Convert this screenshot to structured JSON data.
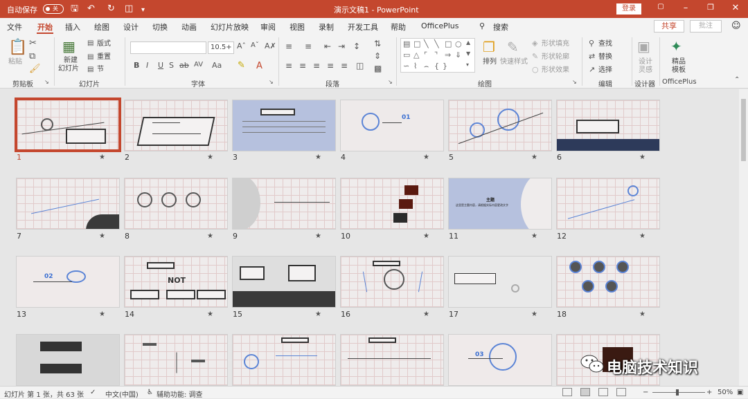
{
  "titlebar": {
    "autosave_label": "自动保存",
    "autosave_state": "关",
    "doc_title": "演示文稿1 - PowerPoint",
    "login": "登录",
    "qa_icons": [
      "save-icon",
      "undo-icon",
      "redo-icon",
      "start-slideshow-icon",
      "customize-icon"
    ]
  },
  "menu": {
    "tabs": [
      "文件",
      "开始",
      "插入",
      "绘图",
      "设计",
      "切换",
      "动画",
      "幻灯片放映",
      "审阅",
      "视图",
      "录制",
      "开发工具",
      "帮助",
      "OfficePlus",
      "搜索"
    ],
    "active": "开始",
    "share": "共享",
    "comment": "批注"
  },
  "ribbon": {
    "groups": [
      "剪贴板",
      "幻灯片",
      "字体",
      "段落",
      "绘图",
      "编辑",
      "设计器",
      "OfficePlus"
    ],
    "paste": "粘贴",
    "new_slide_1": "新建",
    "new_slide_2": "幻灯片",
    "layout": "版式",
    "reset": "重置",
    "section": "节",
    "font_size": "10.5+",
    "arrange": "排列",
    "quick_styles": "快速样式",
    "shape_fill": "形状填充",
    "shape_outline": "形状轮廓",
    "shape_effects": "形状效果",
    "find": "查找",
    "replace": "替换",
    "select": "选择",
    "design_ideas_1": "设计",
    "design_ideas_2": "灵感",
    "boutique_1": "精品",
    "boutique_2": "模板"
  },
  "slides": [
    {
      "n": "1",
      "star": "★"
    },
    {
      "n": "2",
      "star": "★"
    },
    {
      "n": "3",
      "star": "★"
    },
    {
      "n": "4",
      "star": "★"
    },
    {
      "n": "5",
      "star": "★"
    },
    {
      "n": "6",
      "star": "★"
    },
    {
      "n": "7",
      "star": "★"
    },
    {
      "n": "8",
      "star": "★"
    },
    {
      "n": "9",
      "star": "★"
    },
    {
      "n": "10",
      "star": "★"
    },
    {
      "n": "11",
      "star": "★"
    },
    {
      "n": "12",
      "star": "★"
    },
    {
      "n": "13",
      "star": "★"
    },
    {
      "n": "14",
      "star": "★"
    },
    {
      "n": "15",
      "star": "★"
    },
    {
      "n": "16",
      "star": "★"
    },
    {
      "n": "17",
      "star": "★"
    },
    {
      "n": "18",
      "star": "★"
    }
  ],
  "slide_text": {
    "s4_num": "01",
    "s11_title": "主题",
    "s11_text": "这里是主题内容，请根据实际内容更改文字",
    "s13_num": "02",
    "s14_word": "NOT",
    "s23_num": "03"
  },
  "status": {
    "slide_info": "幻灯片 第 1 张，共 63 张",
    "language": "中文(中国)",
    "accessibility": "辅助功能: 调查",
    "notes": "备注",
    "zoom": "50%"
  },
  "watermark": "电脑技术知识",
  "colors": {
    "accent": "#c4472e",
    "selected_border": "#c4472e",
    "blue_slide": "#b6c1de"
  }
}
